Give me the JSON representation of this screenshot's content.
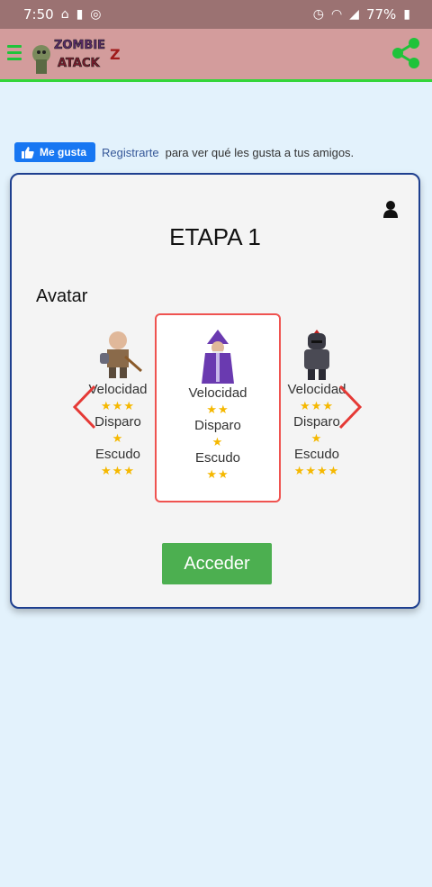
{
  "status_bar": {
    "time": "7:50",
    "battery": "77%",
    "icons": [
      "voicemail-icon",
      "battery-saver-icon",
      "no-disturb-icon",
      "alarm-icon",
      "wifi-icon",
      "signal-icon",
      "battery-icon"
    ]
  },
  "app_bar": {
    "logo_line1": "ZOMBIE",
    "logo_line2": "ATACK",
    "logo_suffix": "Z",
    "icons": [
      "menu-icon",
      "share-icon"
    ],
    "accent_color": "#1fc33a"
  },
  "facebook": {
    "like_label": "Me gusta",
    "register_link": "Registrarte",
    "message": "para ver qué les gusta a tus amigos."
  },
  "card": {
    "title": "ETAPA 1",
    "avatar_heading": "Avatar",
    "avatars": [
      {
        "name": "warrior",
        "speed_label": "Velocidad",
        "speed": "★★★",
        "shot_label": "Disparo",
        "shot": "★",
        "shield_label": "Escudo",
        "shield": "★★★"
      },
      {
        "name": "wizard",
        "speed_label": "Velocidad",
        "speed": "★★",
        "shot_label": "Disparo",
        "shot": "★",
        "shield_label": "Escudo",
        "shield": "★★"
      },
      {
        "name": "knight",
        "speed_label": "Velocidad",
        "speed": "★★★",
        "shot_label": "Disparo",
        "shot": "★",
        "shield_label": "Escudo",
        "shield": "★★★★"
      }
    ],
    "selected_avatar": "wizard",
    "button_label": "Acceder",
    "button_color": "#4caf50",
    "highlight_color": "#ef5350"
  }
}
